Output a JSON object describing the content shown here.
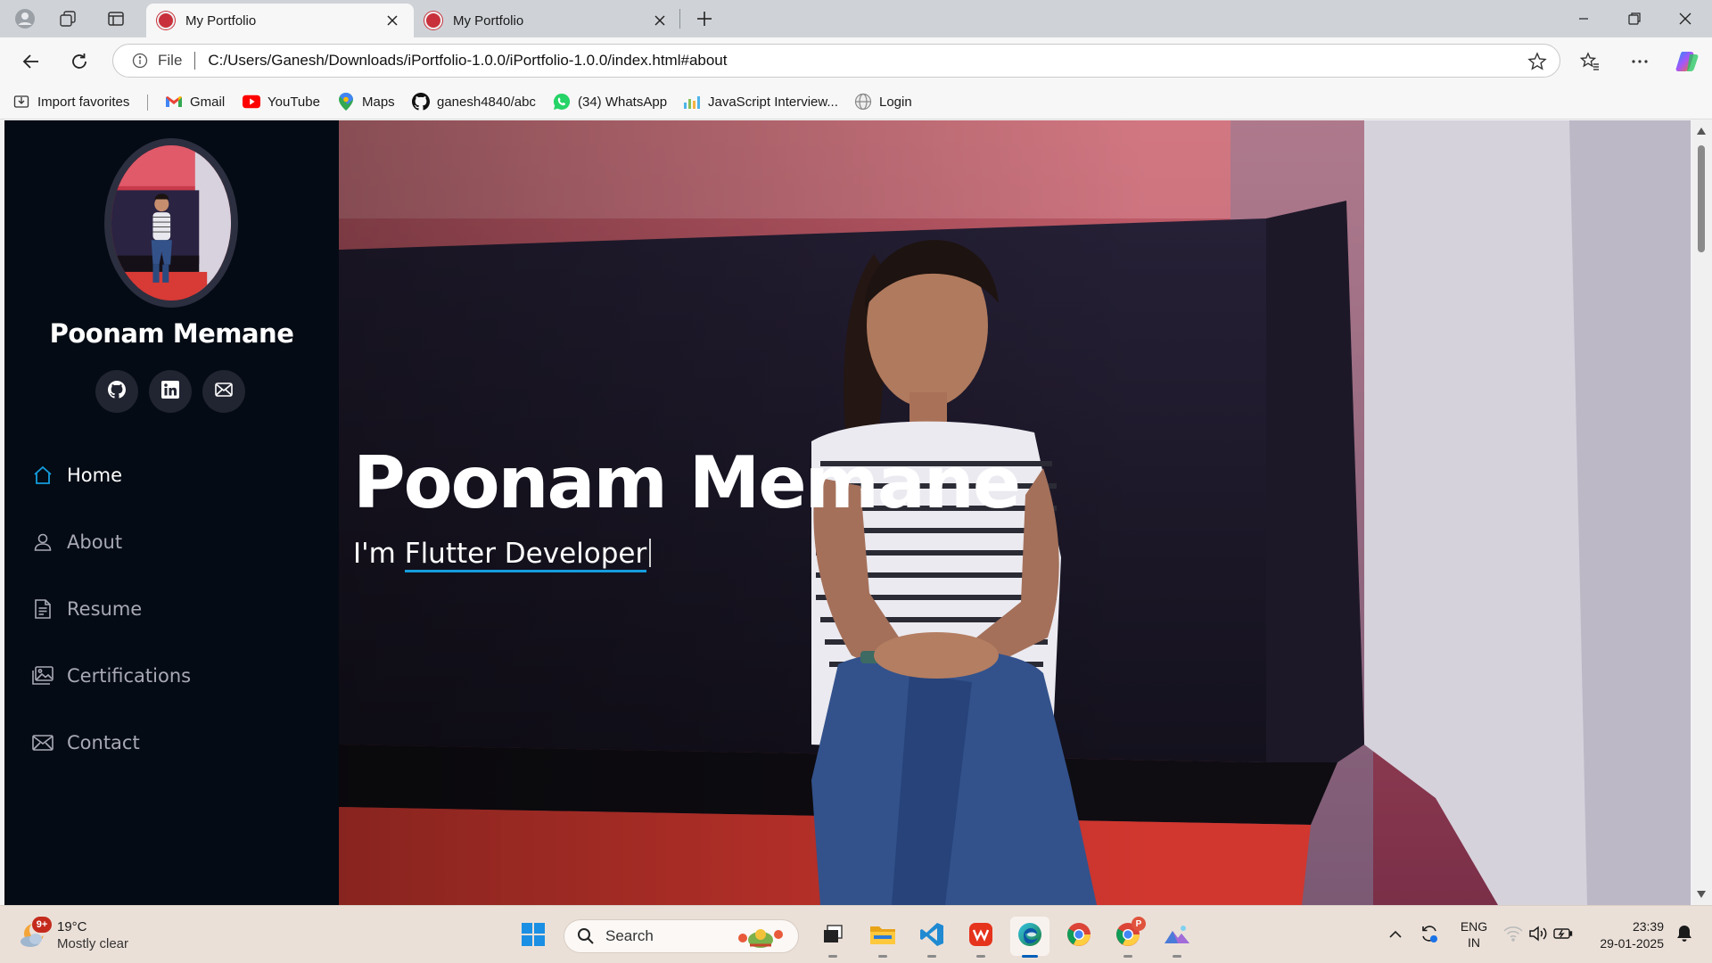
{
  "browser": {
    "tabs": [
      {
        "title": "My Portfolio",
        "active": true
      },
      {
        "title": "My Portfolio",
        "active": false
      }
    ],
    "address": {
      "scheme_label": "File",
      "url": "C:/Users/Ganesh/Downloads/iPortfolio-1.0.0/iPortfolio-1.0.0/index.html#about"
    },
    "favorites": [
      {
        "label": "Import favorites",
        "icon": "import-icon"
      },
      {
        "label": "Gmail",
        "icon": "gmail-icon"
      },
      {
        "label": "YouTube",
        "icon": "youtube-icon"
      },
      {
        "label": "Maps",
        "icon": "maps-pin-icon"
      },
      {
        "label": "ganesh4840/abc",
        "icon": "github-icon"
      },
      {
        "label": "(34) WhatsApp",
        "icon": "whatsapp-icon"
      },
      {
        "label": "JavaScript Interview...",
        "icon": "chart-icon"
      },
      {
        "label": "Login",
        "icon": "globe-icon"
      }
    ]
  },
  "page": {
    "sidebar": {
      "name": "Poonam Memane",
      "socials": [
        "github-icon",
        "linkedin-icon",
        "envelope-icon"
      ],
      "nav": [
        {
          "label": "Home",
          "icon": "house-icon",
          "active": true
        },
        {
          "label": "About",
          "icon": "person-icon",
          "active": false
        },
        {
          "label": "Resume",
          "icon": "file-text-icon",
          "active": false
        },
        {
          "label": "Certifications",
          "icon": "images-icon",
          "active": false
        },
        {
          "label": "Contact",
          "icon": "envelope-icon",
          "active": false
        }
      ]
    },
    "hero": {
      "title": "Poonam Memane",
      "prefix": "I'm",
      "role": "Flutter Developer"
    },
    "accent_color": "#149ddd",
    "sidebar_bg": "#040b14"
  },
  "taskbar": {
    "weather": {
      "temp": "19°C",
      "condition": "Mostly clear",
      "badge": "9+"
    },
    "search_placeholder": "Search",
    "apps": [
      "start-windows-icon",
      "task-view-icon",
      "file-explorer-icon",
      "vscode-icon",
      "wps-office-icon",
      "edge-icon",
      "chrome-icon",
      "chrome-profile-icon",
      "photos-icon"
    ],
    "profile_badge": "P",
    "language": {
      "line1": "ENG",
      "line2": "IN"
    },
    "time": "23:39",
    "date": "29-01-2025"
  }
}
